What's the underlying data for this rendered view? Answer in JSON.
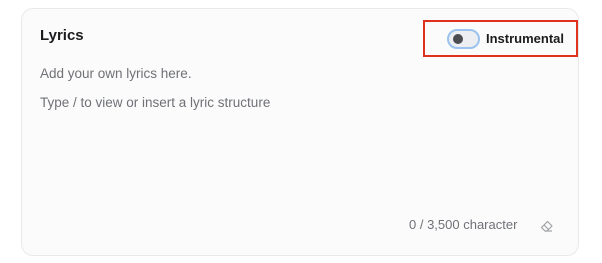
{
  "lyrics": {
    "title": "Lyrics",
    "placeholder_line_1": "Add your own lyrics here.",
    "placeholder_line_2": "Type / to view or insert a lyric structure",
    "character_count": "0 / 3,500 character"
  },
  "instrumental_toggle": {
    "label": "Instrumental",
    "state": "off"
  },
  "icons": {
    "clear": "eraser-icon"
  },
  "colors": {
    "highlight_border": "#e0301e",
    "toggle_border": "#9cc3ef",
    "text_primary": "#1c1c1e",
    "text_secondary": "#6f7176"
  }
}
